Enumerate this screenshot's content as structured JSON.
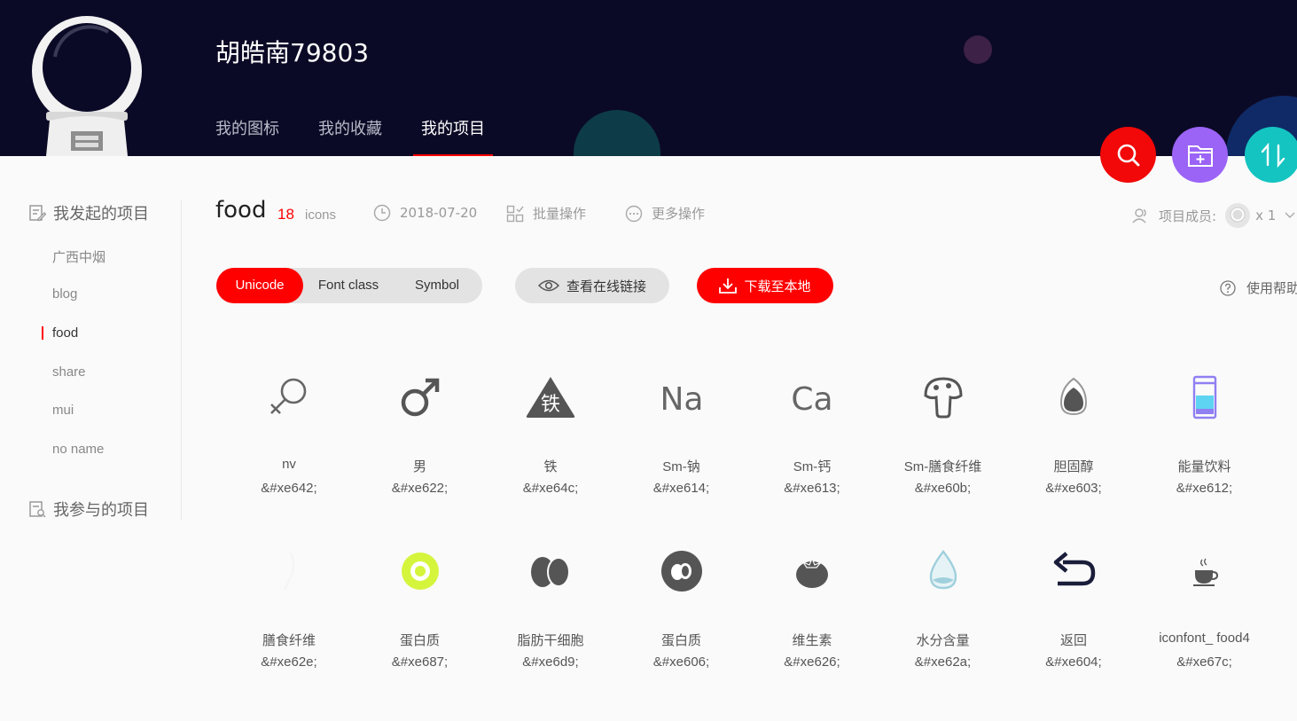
{
  "user": {
    "name": "胡皓南79803"
  },
  "nav": {
    "items": [
      "我的图标",
      "我的收藏",
      "我的项目"
    ],
    "active": 2
  },
  "sidebar": {
    "started_title": "我发起的项目",
    "started_items": [
      "广西中烟",
      "blog",
      "food",
      "share",
      "mui",
      "no name"
    ],
    "active_item": "food",
    "joined_title": "我参与的项目"
  },
  "project": {
    "title": "food",
    "count": "18",
    "count_label": "icons",
    "date": "2018-07-20",
    "batch_label": "批量操作",
    "more_label": "更多操作",
    "members_label": "项目成员:",
    "members_count": "x 1"
  },
  "toolbar": {
    "tabs": [
      "Unicode",
      "Font class",
      "Symbol"
    ],
    "active_tab": "Unicode",
    "online_link_label": "查看在线链接",
    "download_label": "下载至本地",
    "help_label": "使用帮助"
  },
  "icons": [
    {
      "name": "nv",
      "code": "&#xe642;",
      "icon": "female-symbol-icon",
      "color": "#666666"
    },
    {
      "name": "男",
      "code": "&#xe622;",
      "icon": "male-symbol-icon",
      "color": "#555555"
    },
    {
      "name": "铁",
      "code": "&#xe64c;",
      "icon": "iron-triangle-icon",
      "color": "#555555"
    },
    {
      "name": "Sm-钠",
      "code": "&#xe614;",
      "icon": "sodium-na-icon",
      "color": "#666666"
    },
    {
      "name": "Sm-钙",
      "code": "&#xe613;",
      "icon": "calcium-ca-icon",
      "color": "#666666"
    },
    {
      "name": "Sm-膳食纤维",
      "code": "&#xe60b;",
      "icon": "mushroom-icon",
      "color": "#555555"
    },
    {
      "name": "胆固醇",
      "code": "&#xe603;",
      "icon": "cholesterol-icon",
      "color": "#555555"
    },
    {
      "name": "能量饮料",
      "code": "&#xe612;",
      "icon": "energy-drink-icon",
      "color": "#8f7ff2"
    },
    {
      "name": "膳食纤维",
      "code": "&#xe62e;",
      "icon": "fiber-icon",
      "color": "#f5f5f5"
    },
    {
      "name": "蛋白质",
      "code": "&#xe687;",
      "icon": "protein-egg-icon",
      "color": "#d4f53c"
    },
    {
      "name": "脂肪干细胞",
      "code": "&#xe6d9;",
      "icon": "fat-cells-icon",
      "color": "#555555"
    },
    {
      "name": "蛋白质",
      "code": "&#xe606;",
      "icon": "protein-circle-icon",
      "color": "#555555"
    },
    {
      "name": "维生素",
      "code": "&#xe626;",
      "icon": "tomato-icon",
      "color": "#555555"
    },
    {
      "name": "水分含量",
      "code": "&#xe62a;",
      "icon": "water-drop-icon",
      "color": "#9fd0dc"
    },
    {
      "name": "返回",
      "code": "&#xe604;",
      "icon": "return-arrow-icon",
      "color": "#1a1d3a"
    },
    {
      "name": "iconfont_ food4",
      "code": "&#xe67c;",
      "icon": "coffee-cup-icon",
      "color": "#555555"
    }
  ]
}
